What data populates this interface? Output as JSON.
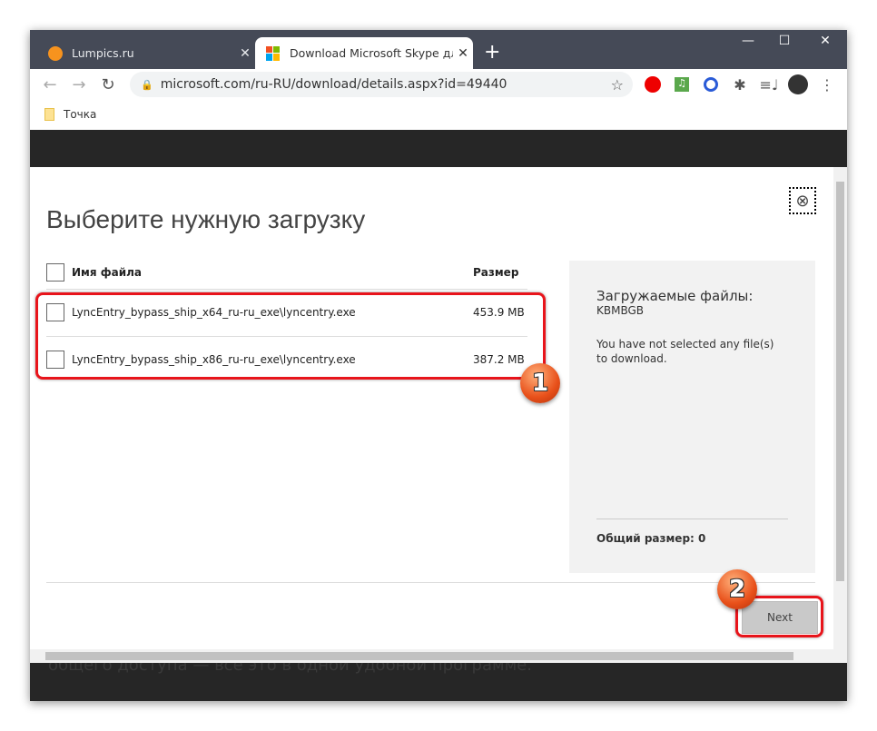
{
  "browser": {
    "tabs": [
      {
        "label": "Lumpics.ru",
        "active": false
      },
      {
        "label": "Download Microsoft Skype для б",
        "active": true
      }
    ],
    "url": "microsoft.com/ru-RU/download/details.aspx?id=49440",
    "bookmarks": [
      {
        "label": "Точка"
      }
    ]
  },
  "dialog": {
    "title": "Выберите нужную загрузку",
    "columns": {
      "name": "Имя файла",
      "size": "Размер"
    },
    "files": [
      {
        "name": "LyncEntry_bypass_ship_x64_ru-ru_exe\\lyncentry.exe",
        "size": "453.9 MB"
      },
      {
        "name": "LyncEntry_bypass_ship_x86_ru-ru_exe\\lyncentry.exe",
        "size": "387.2 MB"
      }
    ],
    "summary": {
      "heading": "Загружаемые файлы:",
      "subheading": "KBMBGB",
      "message": "You have not selected any file(s) to download.",
      "total": "Общий размер: 0"
    },
    "next_label": "Next"
  },
  "background_text": "общего доступа — все это в одной удобной программе.",
  "annotations": {
    "badge1": "1",
    "badge2": "2"
  },
  "colors": {
    "highlight": "#e8141b",
    "badge": "#e8501a"
  }
}
